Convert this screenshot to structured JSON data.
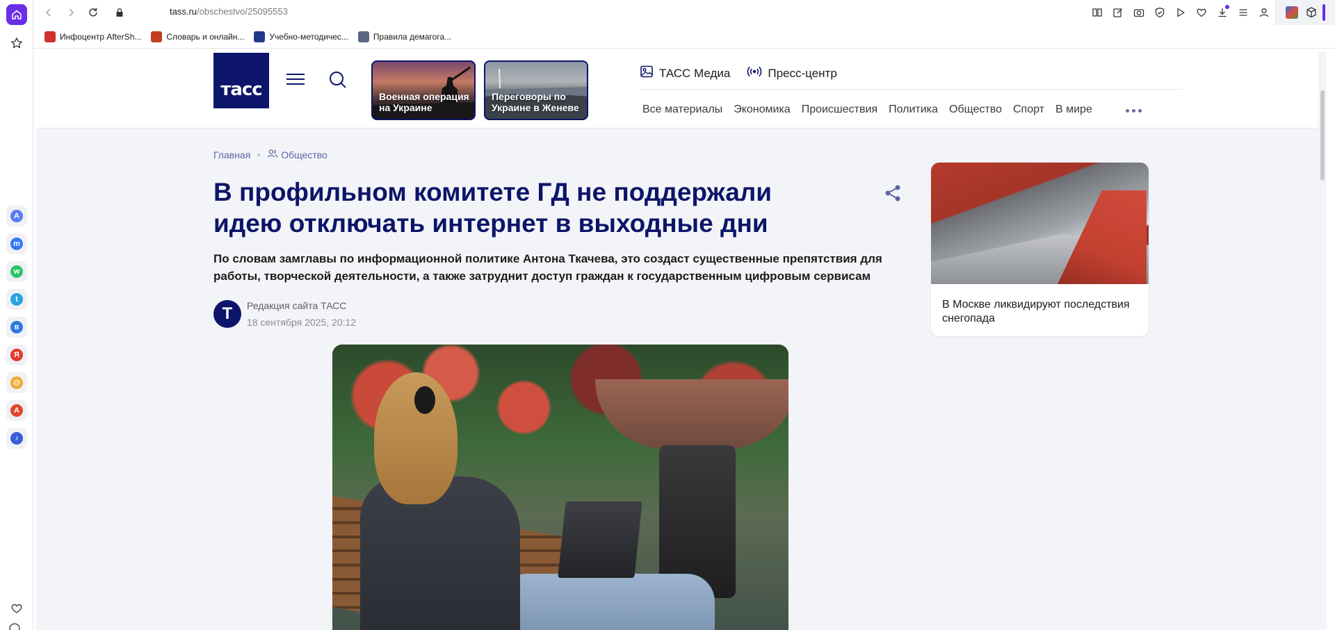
{
  "browser": {
    "url_host": "tass.ru",
    "url_path": "/obschestvo/25095553",
    "bookmarks": [
      {
        "label": "Инфоцентр AfterSh...",
        "color": "#d0312d"
      },
      {
        "label": "Словарь и онлайн...",
        "color": "#c04020"
      },
      {
        "label": "Учебно-методичес...",
        "color": "#1f3a8a"
      },
      {
        "label": "Правила демагога...",
        "color": "#5b6780"
      }
    ],
    "sidebar_apps": [
      {
        "name": "app-1",
        "color": "#5b7cf5",
        "glyph": "А"
      },
      {
        "name": "messenger",
        "color": "#3478f6",
        "glyph": "m"
      },
      {
        "name": "whatsapp",
        "color": "#2cc36b",
        "glyph": "w"
      },
      {
        "name": "telegram",
        "color": "#2aa3e0",
        "glyph": "t"
      },
      {
        "name": "vk",
        "color": "#2a7ae2",
        "glyph": "в"
      },
      {
        "name": "yandex",
        "color": "#e23b2c",
        "glyph": "Я"
      },
      {
        "name": "mail",
        "color": "#f0a830",
        "glyph": "@"
      },
      {
        "name": "translate",
        "color": "#e0452c",
        "glyph": "A"
      },
      {
        "name": "audio",
        "color": "#3a5bd9",
        "glyph": "♪"
      }
    ]
  },
  "site": {
    "logo_text": "тасс",
    "brand_color": "#0c1569",
    "promos": [
      {
        "title": "Военная операция на Украине"
      },
      {
        "title": "Переговоры по Украине в Женеве"
      }
    ],
    "media_links": [
      {
        "label": "ТАСС Медиа",
        "icon": "image-icon"
      },
      {
        "label": "Пресс-центр",
        "icon": "broadcast-icon"
      }
    ],
    "nav": [
      "Все материалы",
      "Экономика",
      "Происшествия",
      "Политика",
      "Общество",
      "Спорт",
      "В мире"
    ]
  },
  "article": {
    "breadcrumb": [
      "Главная",
      "Общество"
    ],
    "headline": "В профильном комитете ГД не поддержали идею отключать интернет в выходные дни",
    "lead": "По словам замглавы по информационной политике Антона Ткачева, это создаст существенные препятствия для работы, творческой деятельности, а также затруднит доступ граждан к государственным цифровым сервисам",
    "author": "Редакция сайта ТАСС",
    "author_initial": "Т",
    "date": "18 сентября 2025, 20:12"
  },
  "sidebar_news": {
    "title": "В Москве ликвидируют последствия снегопада"
  }
}
